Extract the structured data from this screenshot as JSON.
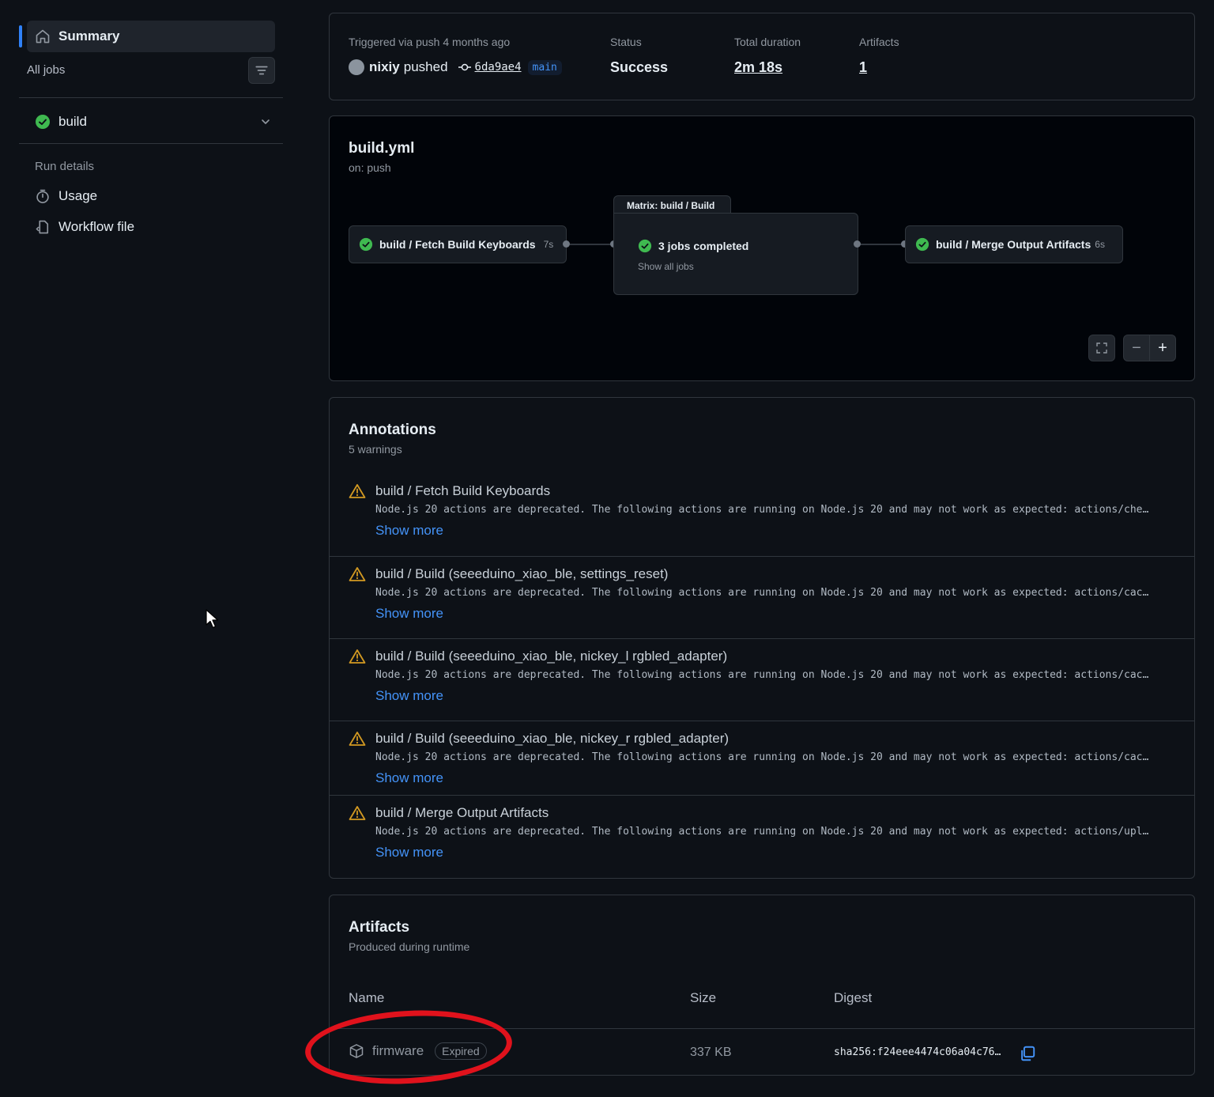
{
  "sidebar": {
    "summary_label": "Summary",
    "all_jobs_label": "All jobs",
    "job_label": "build",
    "run_details_label": "Run details",
    "usage_label": "Usage",
    "workflow_file_label": "Workflow file"
  },
  "run_meta": {
    "trigger_label": "Triggered via push 4 months ago",
    "actor": "nixiy",
    "actor_action": "pushed",
    "commit_sha": "6da9ae4",
    "branch": "main",
    "status_label": "Status",
    "status_value": "Success",
    "duration_label": "Total duration",
    "duration_value": "2m 18s",
    "artifacts_label": "Artifacts",
    "artifacts_value": "1"
  },
  "workflow": {
    "file": "build.yml",
    "trigger": "on: push",
    "matrix_tab": "Matrix: build / Build",
    "nodes": {
      "fetch": {
        "label": "build / Fetch Build Keyboards",
        "duration": "7s"
      },
      "matrix": {
        "label": "3 jobs completed",
        "sub": "Show all jobs"
      },
      "merge": {
        "label": "build / Merge Output Artifacts",
        "duration": "6s"
      }
    },
    "controls": {
      "zoom_out": "−",
      "zoom_in": "+"
    }
  },
  "annotations": {
    "title": "Annotations",
    "subtitle": "5 warnings",
    "show_more": "Show more",
    "items": [
      {
        "title": "build / Fetch Build Keyboards",
        "message": "Node.js 20 actions are deprecated. The following actions are running on Node.js 20 and may not work as expected: actions/che…"
      },
      {
        "title": "build / Build (seeeduino_xiao_ble, settings_reset)",
        "message": "Node.js 20 actions are deprecated. The following actions are running on Node.js 20 and may not work as expected: actions/cac…"
      },
      {
        "title": "build / Build (seeeduino_xiao_ble, nickey_l rgbled_adapter)",
        "message": "Node.js 20 actions are deprecated. The following actions are running on Node.js 20 and may not work as expected: actions/cac…"
      },
      {
        "title": "build / Build (seeeduino_xiao_ble, nickey_r rgbled_adapter)",
        "message": "Node.js 20 actions are deprecated. The following actions are running on Node.js 20 and may not work as expected: actions/cac…"
      },
      {
        "title": "build / Merge Output Artifacts",
        "message": "Node.js 20 actions are deprecated. The following actions are running on Node.js 20 and may not work as expected: actions/upl…"
      }
    ]
  },
  "artifacts": {
    "title": "Artifacts",
    "subtitle": "Produced during runtime",
    "columns": {
      "name": "Name",
      "size": "Size",
      "digest": "Digest"
    },
    "rows": [
      {
        "name": "firmware",
        "badge": "Expired",
        "size": "337 KB",
        "digest": "sha256:f24eee4474c06a04c76…"
      }
    ]
  },
  "colors": {
    "background": "#0d1117",
    "accent": "#2f81f7",
    "success": "#3fb950",
    "warning": "#d29922",
    "annotation_circle": "#e0121c"
  }
}
